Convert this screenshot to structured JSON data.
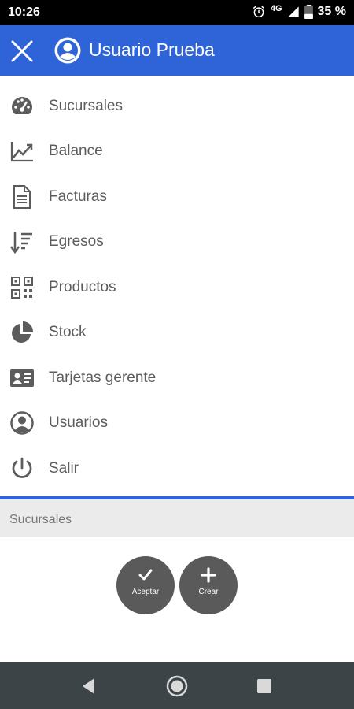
{
  "status_bar": {
    "time": "10:26",
    "network": "4G",
    "battery": "35 %",
    "icons": [
      "alarm-icon",
      "signal-icon",
      "battery-icon"
    ]
  },
  "header": {
    "title": "Usuario Prueba",
    "close_icon": "close-icon",
    "avatar_icon": "account-circle-icon",
    "color": "#2f63d8"
  },
  "menu": {
    "items": [
      {
        "label": "Sucursales",
        "icon": "dashboard-icon"
      },
      {
        "label": "Balance",
        "icon": "trending-up-icon"
      },
      {
        "label": "Facturas",
        "icon": "document-icon"
      },
      {
        "label": "Egresos",
        "icon": "sort-descending-icon"
      },
      {
        "label": "Productos",
        "icon": "qr-code-icon"
      },
      {
        "label": "Stock",
        "icon": "pie-chart-icon"
      },
      {
        "label": "Tarjetas gerente",
        "icon": "id-card-icon"
      },
      {
        "label": "Usuarios",
        "icon": "account-circle-icon"
      },
      {
        "label": "Salir",
        "icon": "power-icon"
      }
    ]
  },
  "page": {
    "title": "Sucursales"
  },
  "actions": {
    "accept_label": "Aceptar",
    "create_label": "Crear"
  },
  "nav_bar": {
    "buttons": [
      "back-icon",
      "home-icon",
      "recents-icon"
    ]
  }
}
